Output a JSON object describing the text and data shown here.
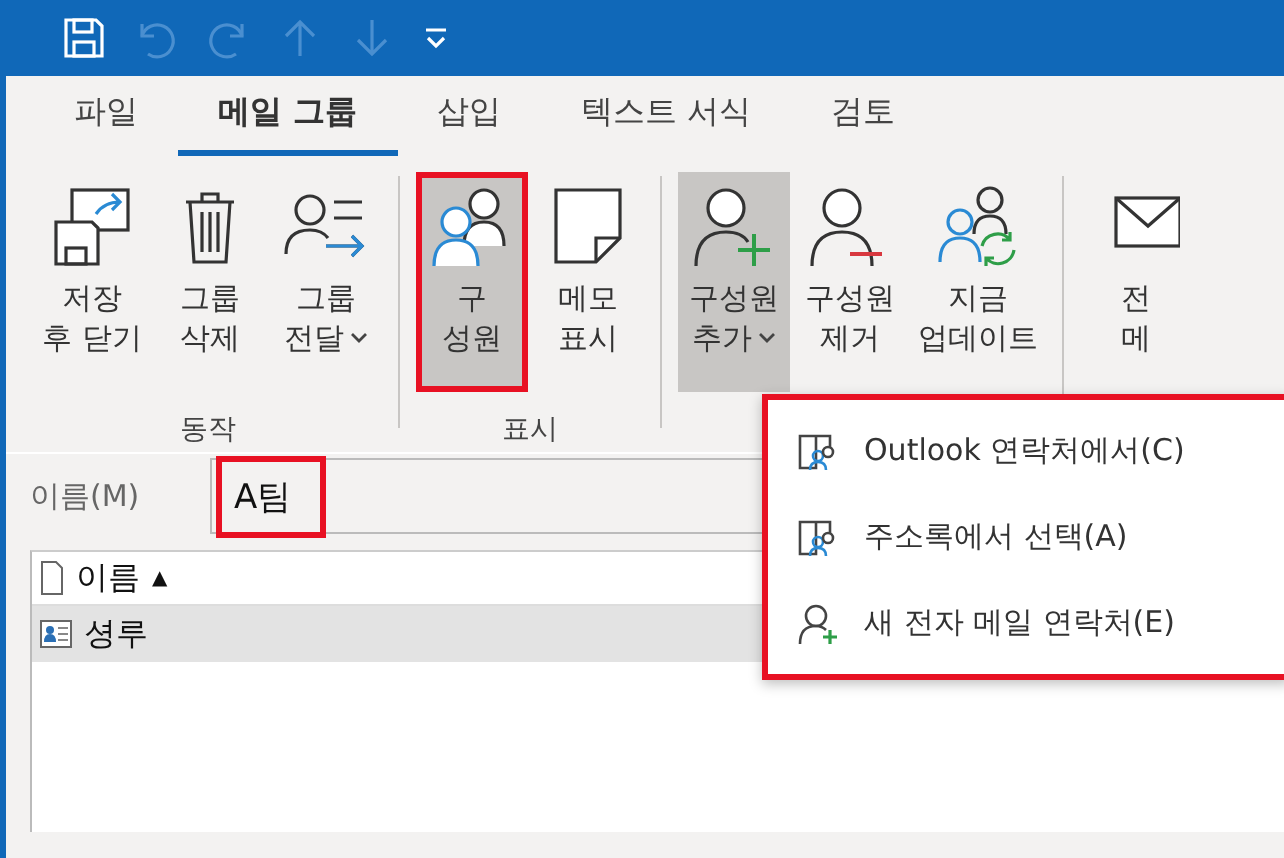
{
  "quick_access": [
    {
      "kind": "save",
      "disabled": false
    },
    {
      "kind": "undo",
      "disabled": true
    },
    {
      "kind": "redo",
      "disabled": true
    },
    {
      "kind": "up",
      "disabled": true
    },
    {
      "kind": "down",
      "disabled": true
    },
    {
      "kind": "customize",
      "disabled": false
    }
  ],
  "tabs": [
    {
      "label": "파일",
      "selected": false
    },
    {
      "label": "메일 그룹",
      "selected": true
    },
    {
      "label": "삽입",
      "selected": false
    },
    {
      "label": "텍스트 서식",
      "selected": false
    },
    {
      "label": "검토",
      "selected": false
    }
  ],
  "groups": [
    {
      "label": "동작",
      "buttons": [
        {
          "kind": "saveclose",
          "lines": [
            "저장",
            "후 닫기"
          ],
          "dropdown": false,
          "selected": false,
          "highlighted": false
        },
        {
          "kind": "delete",
          "lines": [
            "그룹",
            "삭제"
          ],
          "dropdown": false,
          "selected": false,
          "highlighted": false
        },
        {
          "kind": "forward",
          "lines": [
            "그룹",
            "전달"
          ],
          "dropdown": true,
          "selected": false,
          "highlighted": false
        }
      ]
    },
    {
      "label": "표시",
      "buttons": [
        {
          "kind": "members",
          "lines": [
            "구",
            "성원"
          ],
          "dropdown": false,
          "selected": true,
          "highlighted": true
        },
        {
          "kind": "notes",
          "lines": [
            "메모",
            "표시"
          ],
          "dropdown": false,
          "selected": false,
          "highlighted": false
        }
      ]
    },
    {
      "buttons": [
        {
          "kind": "addmember",
          "lines": [
            "구성원",
            "추가"
          ],
          "dropdown": true,
          "selected": true,
          "highlighted": false
        },
        {
          "kind": "removemember",
          "lines": [
            "구성원",
            "제거"
          ],
          "dropdown": false,
          "selected": false,
          "highlighted": false
        },
        {
          "kind": "update",
          "lines": [
            "지금",
            "업데이트"
          ],
          "dropdown": false,
          "selected": false,
          "highlighted": false
        }
      ]
    },
    {
      "buttons": [
        {
          "kind": "email",
          "lines": [
            "전",
            "메"
          ],
          "dropdown": false,
          "selected": false,
          "highlighted": false
        }
      ]
    }
  ],
  "name_field": {
    "label": "이름(M)",
    "value": "A팀",
    "highlighted": true
  },
  "list": {
    "column": "이름",
    "sort": "▲",
    "rows": [
      {
        "name": "셩루",
        "selected": true
      }
    ]
  },
  "menu": {
    "highlighted": true,
    "items": [
      {
        "kind": "contacts",
        "label": "Outlook 연락처에서(C)"
      },
      {
        "kind": "addressbook",
        "label": "주소록에서 선택(A)"
      },
      {
        "kind": "newcontact",
        "label": "새 전자 메일 연락처(E)"
      }
    ]
  }
}
